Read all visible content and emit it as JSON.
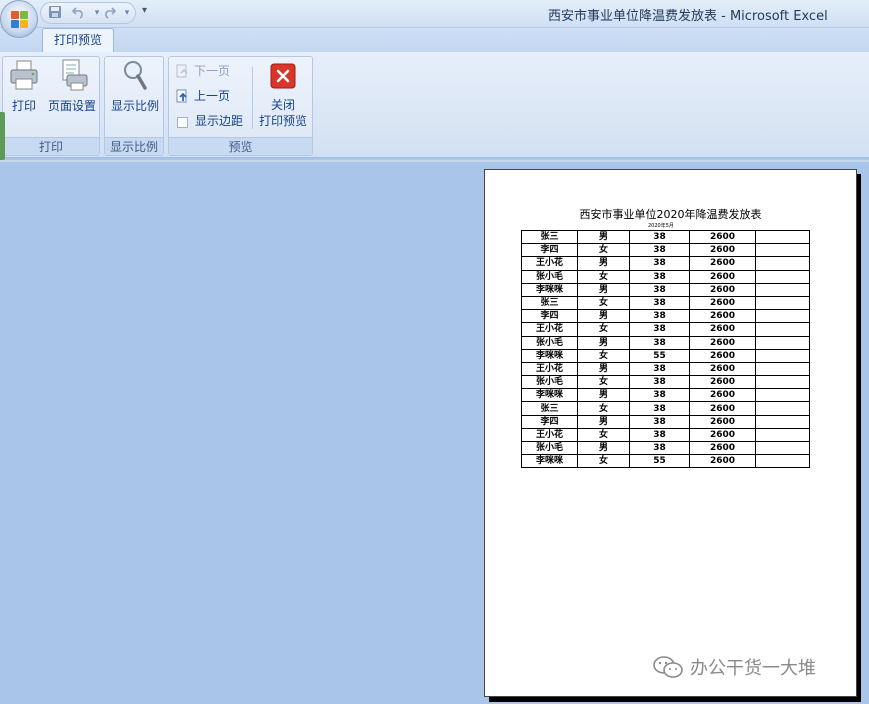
{
  "window": {
    "title": "西安市事业单位降温费发放表 - Microsoft Excel"
  },
  "quick_access": {
    "icons": [
      "save-icon",
      "undo-icon",
      "redo-icon"
    ],
    "customize_label": "▾"
  },
  "ribbon": {
    "active_tab": "打印预览",
    "groups": {
      "print": {
        "label": "打印",
        "print_label": "打印",
        "page_setup_label": "页面设置"
      },
      "zoom": {
        "label": "显示比例",
        "zoom_label": "显示比例"
      },
      "preview": {
        "label": "预览",
        "next_page_label": "下一页",
        "prev_page_label": "上一页",
        "show_margins_label": "显示边距",
        "show_margins_checked": false,
        "close_label_line1": "关闭",
        "close_label_line2": "打印预览"
      }
    }
  },
  "sheet": {
    "title": "西安市事业单位2020年降温费发放表",
    "subtitle": "2020年5月",
    "rows": [
      [
        "张三",
        "男",
        "38",
        "2600",
        ""
      ],
      [
        "李四",
        "女",
        "38",
        "2600",
        ""
      ],
      [
        "王小花",
        "男",
        "38",
        "2600",
        ""
      ],
      [
        "张小毛",
        "女",
        "38",
        "2600",
        ""
      ],
      [
        "李咪咪",
        "男",
        "38",
        "2600",
        ""
      ],
      [
        "张三",
        "女",
        "38",
        "2600",
        ""
      ],
      [
        "李四",
        "男",
        "38",
        "2600",
        ""
      ],
      [
        "王小花",
        "女",
        "38",
        "2600",
        ""
      ],
      [
        "张小毛",
        "男",
        "38",
        "2600",
        ""
      ],
      [
        "李咪咪",
        "女",
        "55",
        "2600",
        ""
      ],
      [
        "王小花",
        "男",
        "38",
        "2600",
        ""
      ],
      [
        "张小毛",
        "女",
        "38",
        "2600",
        ""
      ],
      [
        "李咪咪",
        "男",
        "38",
        "2600",
        ""
      ],
      [
        "张三",
        "女",
        "38",
        "2600",
        ""
      ],
      [
        "李四",
        "男",
        "38",
        "2600",
        ""
      ],
      [
        "王小花",
        "女",
        "38",
        "2600",
        ""
      ],
      [
        "张小毛",
        "男",
        "38",
        "2600",
        ""
      ],
      [
        "李咪咪",
        "女",
        "55",
        "2600",
        ""
      ]
    ]
  },
  "watermark": {
    "text": "办公干货一大堆"
  },
  "colors": {
    "preview_bg": "#a9c6ea",
    "ribbon_text": "#15428b",
    "close_red": "#d9352b"
  }
}
